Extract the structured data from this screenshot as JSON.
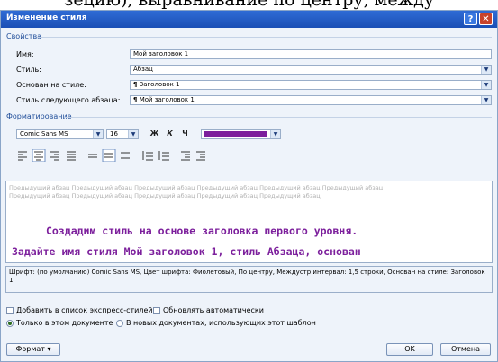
{
  "background_text": "зецию), выравнивание по центру, между",
  "window": {
    "title": "Изменение стиля",
    "help_label": "?",
    "close_label": "✕"
  },
  "properties": {
    "section_label": "Свойства",
    "name_label": "Имя:",
    "name_value": "Мой заголовок 1",
    "style_type_label": "Стиль:",
    "style_type_value": "Абзац",
    "based_on_label": "Основан на стиле:",
    "based_on_value": "Заголовок 1",
    "next_style_label": "Стиль следующего абзаца:",
    "next_style_value": "Мой заголовок 1",
    "paragraph_mark": "¶"
  },
  "formatting": {
    "section_label": "Форматирование",
    "font_value": "Comic Sans MS",
    "size_value": "16",
    "bold_label": "Ж",
    "italic_label": "К",
    "underline_label": "Ч",
    "font_color": "#7c1f9c"
  },
  "preview": {
    "prev_paragraph_text": "Предыдущий абзац Предыдущий абзац Предыдущий абзац Предыдущий абзац Предыдущий абзац Предыдущий абзац Предыдущий абзац Предыдущий абзац Предыдущий абзац Предыдущий абзац Предыдущий абзац",
    "line1": "Создадим стиль на основе заголовка первого уровня.",
    "line2": "Задайте имя стиля Мой заголовок 1, стиль Абзаца, основан"
  },
  "description": "Шрифт: (по умолчанию) Comic Sans MS, Цвет шрифта: Фиолетовый, По центру, Междустр.интервал:  1,5 строки, Основан на стиле: Заголовок 1",
  "options": {
    "add_to_quick_label": "Добавить в список экспресс-стилей",
    "auto_update_label": "Обновлять автоматически",
    "only_this_doc_label": "Только в этом документе",
    "new_docs_label": "В новых документах, использующих этот шаблон"
  },
  "buttons": {
    "format_label": "Формат ▾",
    "ok_label": "OK",
    "cancel_label": "Отмена"
  }
}
